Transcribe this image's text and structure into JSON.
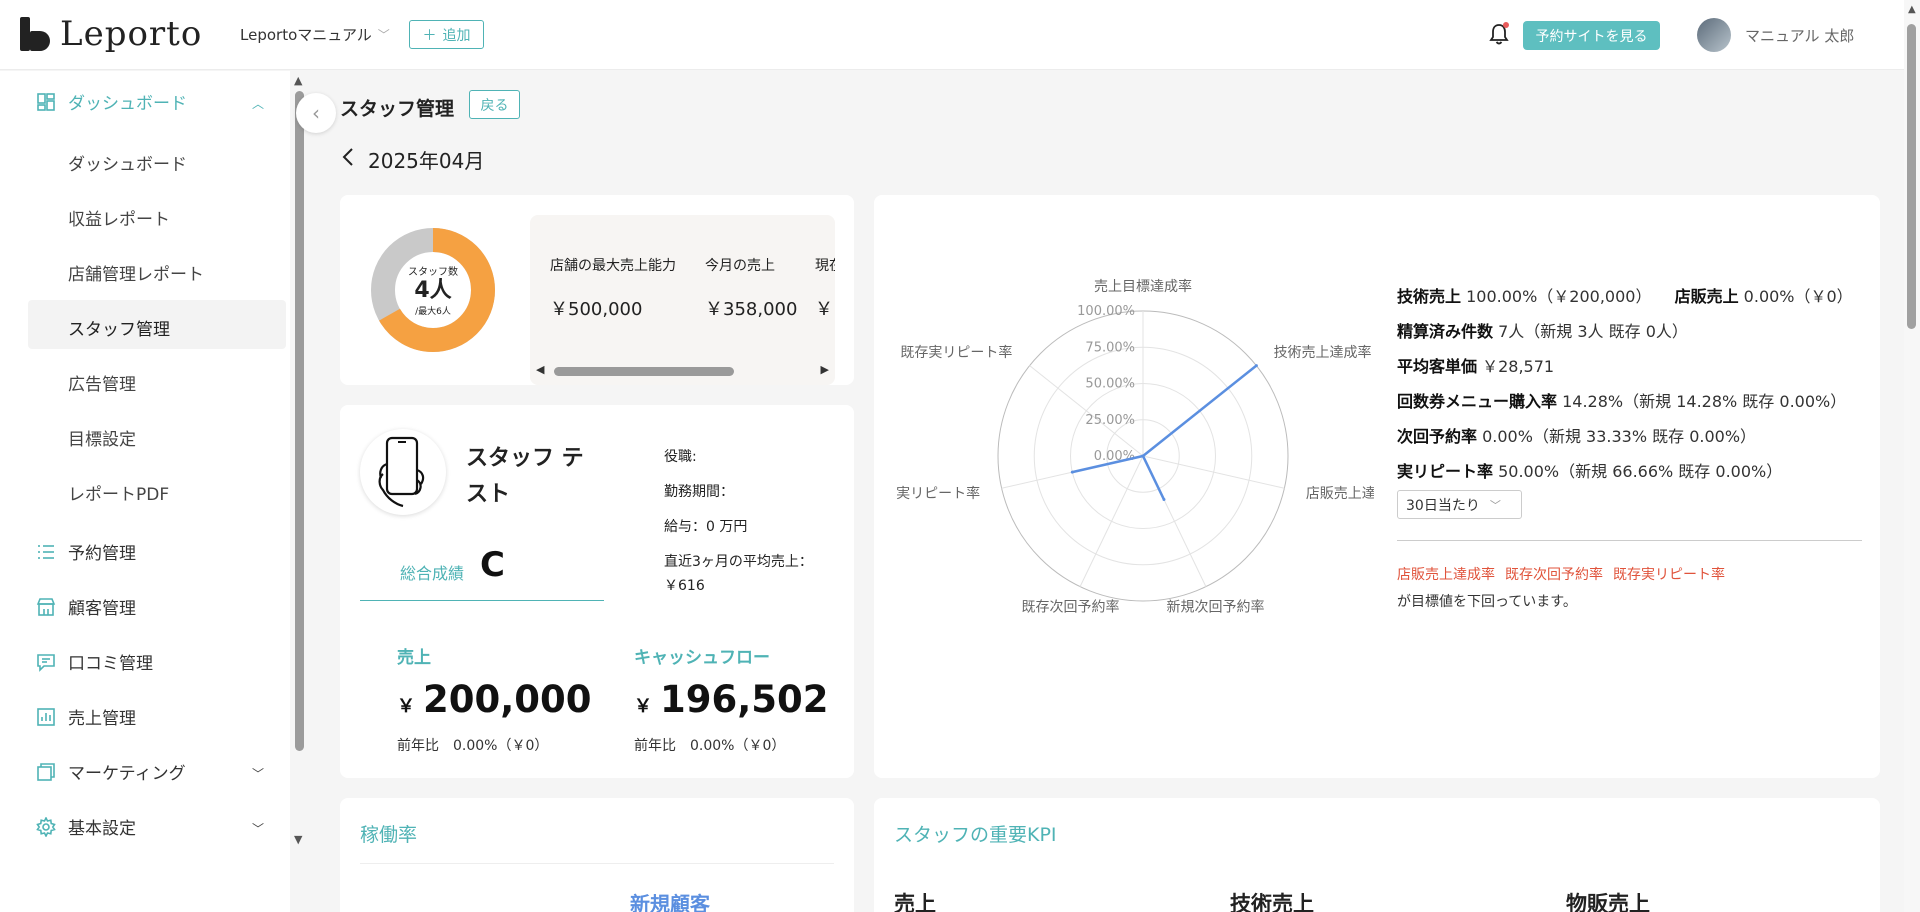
{
  "header": {
    "logo_text": "Leporto",
    "shop_name": "Leportoマニュアル",
    "add_label": "追加",
    "reserve_site_label": "予約サイトを見る",
    "user_name": "マニュアル 太郎"
  },
  "sidebar": {
    "dashboard_group": "ダッシュボード",
    "sub_items": [
      "ダッシュボード",
      "収益レポート",
      "店舗管理レポート",
      "スタッフ管理",
      "広告管理",
      "目標設定",
      "レポートPDF"
    ],
    "items": [
      "予約管理",
      "顧客管理",
      "口コミ管理",
      "売上管理",
      "マーケティング",
      "基本設定"
    ]
  },
  "page": {
    "title": "スタッフ管理",
    "back_label": "戻る",
    "month": "2025年04月"
  },
  "staff_count": {
    "label": "スタッフ数",
    "value": "4人",
    "max": "/最大6人",
    "current": 4,
    "maximum": 6
  },
  "capacity": {
    "columns": [
      {
        "label": "店舗の最大売上能力",
        "value": "￥500,000"
      },
      {
        "label": "今月の売上",
        "value": "￥358,000"
      },
      {
        "label": "現在",
        "value": "￥"
      }
    ]
  },
  "staff": {
    "name": "スタッフ テスト",
    "overall_label": "総合成績",
    "overall_grade": "C",
    "position": "役職:",
    "period": "勤務期間：",
    "salary": "給与：0 万円",
    "avg_sales_label": "直近3ヶ月の平均売上：",
    "avg_sales_value": "￥616",
    "sales_label": "売上",
    "sales_yen": "￥",
    "sales_value": "200,000",
    "sales_yoy": "前年比　0.00%（￥0）",
    "cashflow_label": "キャッシュフロー",
    "cashflow_yen": "￥",
    "cashflow_value": "196,502",
    "cashflow_yoy": "前年比　0.00%（￥0）"
  },
  "radar": {
    "axes": [
      "売上目標達成率",
      "技術売上達成率",
      "店販売上達",
      "新規次回予約率",
      "既存次回予約率",
      "実リピート率",
      "既存実リピート率"
    ],
    "ticks": [
      "100.00%",
      "75.00%",
      "50.00%",
      "25.00%",
      "0.00%"
    ],
    "values": [
      0,
      100,
      0,
      33.33,
      0,
      50,
      0
    ],
    "line_color": "#5b8fe0"
  },
  "stats": {
    "tech_sales_label": "技術売上",
    "tech_sales_value": "100.00%（￥200,000）",
    "retail_sales_label": "店販売上",
    "retail_sales_value": "0.00%（￥0）",
    "settled_label": "精算済み件数",
    "settled_value": "7人（新規 3人 既存 0人）",
    "avg_price_label": "平均客単価",
    "avg_price_value": "￥28,571",
    "ticket_label": "回数券メニュー購入率",
    "ticket_value": "14.28%（新規 14.28% 既存 0.00%）",
    "next_label": "次回予約率",
    "next_value": "0.00%（新規 33.33% 既存 0.00%）",
    "repeat_label": "実リピート率",
    "repeat_value": "50.00%（新規 66.66% 既存 0.00%）",
    "period_option": "30日当たり",
    "warnings": [
      "店販売上達成率",
      "既存次回予約率",
      "既存実リピート率"
    ],
    "warning_text": "が目標値を下回っています。"
  },
  "utilization": {
    "title": "稼働率",
    "new_customer": "新規顧客"
  },
  "key_kpi": {
    "title": "スタッフの重要KPI",
    "cols": [
      "売上",
      "技術売上",
      "物販売上"
    ]
  }
}
